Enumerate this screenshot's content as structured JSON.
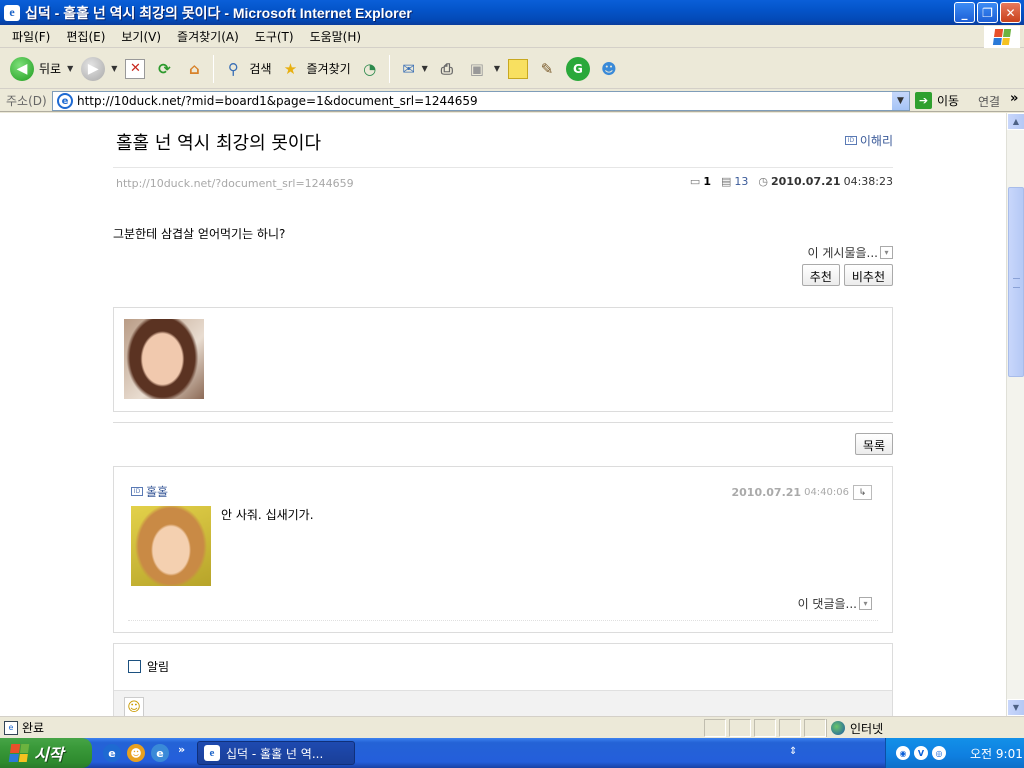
{
  "window": {
    "title": "십덕 - 홀홀 넌 역시 최강의 못이다 - Microsoft Internet Explorer",
    "minimize": "_",
    "maximize": "❐",
    "close": "✕"
  },
  "menu": [
    "파일(F)",
    "편집(E)",
    "보기(V)",
    "즐겨찾기(A)",
    "도구(T)",
    "도움말(H)"
  ],
  "toolbar": {
    "back_label": "뒤로",
    "search_label": "검색",
    "favorites_label": "즐겨찾기"
  },
  "address": {
    "label": "주소(D)",
    "url": "http://10duck.net/?mid=board1&page=1&document_srl=1244659",
    "go_label": "이동",
    "links_label": "연결"
  },
  "document": {
    "title": "홀홀 넌 역시 최강의 못이다",
    "author": "이해리",
    "permalink": "http://10duck.net/?document_srl=1244659",
    "comment_count": "1",
    "view_count": "13",
    "date": "2010.07.21",
    "time": "04:38:23",
    "body": "그분한테 삼겹살 얻어먹기는 하니?",
    "this_post_label": "이 게시물을...",
    "recommend_label": "추천",
    "not_recommend_label": "비추천",
    "list_label": "목록"
  },
  "comment": {
    "author": "홀홀",
    "date": "2010.07.21",
    "time": "04:40:06",
    "text": "안 사줘. 십새기가.",
    "this_comment_label": "이 댓글을..."
  },
  "notify": {
    "label": "알림"
  },
  "statusbar": {
    "status": "완료",
    "zone": "인터넷"
  },
  "taskbar": {
    "start_label": "시작",
    "task_label": "십덕 - 홀홀 넌 역...",
    "clock": "오전 9:01"
  }
}
